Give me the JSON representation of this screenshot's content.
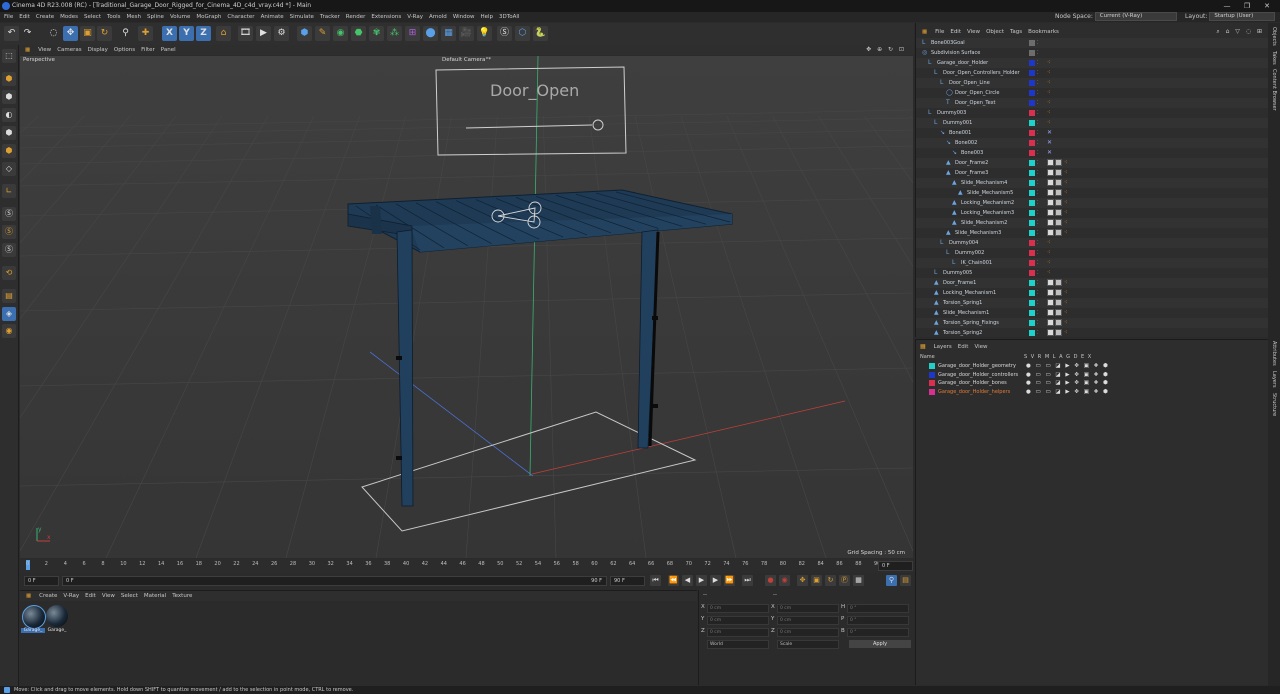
{
  "window": {
    "title": "Cinema 4D R23.008 (RC) - [Traditional_Garage_Door_Rigged_for_Cinema_4D_c4d_vray.c4d *] - Main",
    "controls": [
      "—",
      "❐",
      "✕"
    ]
  },
  "menubar": {
    "items": [
      "File",
      "Edit",
      "Create",
      "Modes",
      "Select",
      "Tools",
      "Mesh",
      "Spline",
      "Volume",
      "MoGraph",
      "Character",
      "Animate",
      "Simulate",
      "Tracker",
      "Render",
      "Extensions",
      "V-Ray",
      "Arnold",
      "Window",
      "Help",
      "3DToAll"
    ],
    "node_space_label": "Node Space:",
    "node_space_value": "Current (V-Ray)",
    "layout_label": "Layout:",
    "layout_value": "Startup (User)"
  },
  "toolbar": {
    "x_label": "X",
    "y_label": "Y",
    "z_label": "Z"
  },
  "viewport": {
    "menu": [
      "View",
      "Cameras",
      "Display",
      "Options",
      "Filter",
      "Panel"
    ],
    "label": "Perspective",
    "camera": "Default Camera",
    "camera_marker": "°*",
    "grid_spacing": "Grid Spacing : 50 cm",
    "scene_text": "Door_Open",
    "axis_y": "y",
    "axis_x": "x"
  },
  "timeline": {
    "ticks": [
      "0",
      "2",
      "4",
      "6",
      "8",
      "10",
      "12",
      "14",
      "16",
      "18",
      "20",
      "22",
      "24",
      "26",
      "28",
      "30",
      "32",
      "34",
      "36",
      "38",
      "40",
      "42",
      "44",
      "46",
      "48",
      "50",
      "52",
      "54",
      "56",
      "58",
      "60",
      "62",
      "64",
      "66",
      "68",
      "70",
      "72",
      "74",
      "76",
      "78",
      "80",
      "82",
      "84",
      "86",
      "88",
      "90"
    ],
    "end_field": "0 F"
  },
  "transport": {
    "current": "0 F",
    "start": "0 F",
    "range_end": "90 F",
    "end": "90 F"
  },
  "materials": {
    "menu": [
      "Create",
      "V-Ray",
      "Edit",
      "View",
      "Select",
      "Material",
      "Texture"
    ],
    "items": [
      {
        "name": "Garage_"
      },
      {
        "name": "Garage_"
      }
    ]
  },
  "attributes": {
    "header": "--",
    "col2": "--",
    "rows": [
      {
        "l1": "X",
        "v1": "0 cm",
        "l2": "X",
        "v2": "0 cm",
        "l3": "H",
        "v3": "0 °"
      },
      {
        "l1": "Y",
        "v1": "0 cm",
        "l2": "Y",
        "v2": "0 cm",
        "l3": "P",
        "v3": "0 °"
      },
      {
        "l1": "Z",
        "v1": "0 cm",
        "l2": "Z",
        "v2": "0 cm",
        "l3": "B",
        "v3": "0 °"
      }
    ],
    "coord_system": "World",
    "mode": "Scale",
    "apply": "Apply"
  },
  "objects": {
    "menu": [
      "File",
      "Edit",
      "View",
      "Object",
      "Tags",
      "Bookmarks"
    ],
    "rows": [
      {
        "name": "Bone003Goal",
        "indent": 0,
        "color": "#6d6d6d",
        "icon": "L"
      },
      {
        "name": "Subdivision Surface",
        "indent": 0,
        "color": "#6d6d6d",
        "icon": "◎"
      },
      {
        "name": "Garage_door_Holder",
        "indent": 1,
        "color": "#1f37c9",
        "icon": "L"
      },
      {
        "name": "Door_Open_Controllers_Holder",
        "indent": 2,
        "color": "#1f37c9",
        "icon": "L"
      },
      {
        "name": "Door_Open_Line",
        "indent": 3,
        "color": "#1f37c9",
        "icon": "L"
      },
      {
        "name": "Door_Open_Circle",
        "indent": 4,
        "color": "#1f37c9",
        "icon": "◯"
      },
      {
        "name": "Door_Open_Text",
        "indent": 4,
        "color": "#1f37c9",
        "icon": "T"
      },
      {
        "name": "Dummy003",
        "indent": 1,
        "color": "#d9304f",
        "icon": "L"
      },
      {
        "name": "Dummy001",
        "indent": 2,
        "color": "#1fd1c9",
        "icon": "L"
      },
      {
        "name": "Bone001",
        "indent": 3,
        "color": "#d9304f",
        "icon": "↘"
      },
      {
        "name": "Bone002",
        "indent": 4,
        "color": "#d9304f",
        "icon": "↘"
      },
      {
        "name": "Bone003",
        "indent": 5,
        "color": "#d9304f",
        "icon": "↘"
      },
      {
        "name": "Door_Frame2",
        "indent": 4,
        "color": "#1fd1c9",
        "icon": "▲"
      },
      {
        "name": "Door_Frame3",
        "indent": 4,
        "color": "#1fd1c9",
        "icon": "▲"
      },
      {
        "name": "Slide_Mechanism4",
        "indent": 5,
        "color": "#1fd1c9",
        "icon": "▲"
      },
      {
        "name": "Slide_Mechanism5",
        "indent": 6,
        "color": "#1fd1c9",
        "icon": "▲"
      },
      {
        "name": "Locking_Mechanism2",
        "indent": 5,
        "color": "#1fd1c9",
        "icon": "▲"
      },
      {
        "name": "Locking_Mechanism3",
        "indent": 5,
        "color": "#1fd1c9",
        "icon": "▲"
      },
      {
        "name": "Slide_Mechanism2",
        "indent": 5,
        "color": "#1fd1c9",
        "icon": "▲"
      },
      {
        "name": "Slide_Mechanism3",
        "indent": 4,
        "color": "#1fd1c9",
        "icon": "▲"
      },
      {
        "name": "Dummy004",
        "indent": 3,
        "color": "#d9304f",
        "icon": "L"
      },
      {
        "name": "Dummy002",
        "indent": 4,
        "color": "#d9304f",
        "icon": "L"
      },
      {
        "name": "IK_Chain001",
        "indent": 5,
        "color": "#d9304f",
        "icon": "L"
      },
      {
        "name": "Dummy005",
        "indent": 2,
        "color": "#d9304f",
        "icon": "L"
      },
      {
        "name": "Door_Frame1",
        "indent": 2,
        "color": "#1fd1c9",
        "icon": "▲"
      },
      {
        "name": "Locking_Mechanism1",
        "indent": 2,
        "color": "#1fd1c9",
        "icon": "▲"
      },
      {
        "name": "Torsion_Spring1",
        "indent": 2,
        "color": "#1fd1c9",
        "icon": "▲"
      },
      {
        "name": "Slide_Mechanism1",
        "indent": 2,
        "color": "#1fd1c9",
        "icon": "▲"
      },
      {
        "name": "Torsion_Spring_Fixings",
        "indent": 2,
        "color": "#1fd1c9",
        "icon": "▲"
      },
      {
        "name": "Torsion_Spring2",
        "indent": 2,
        "color": "#1fd1c9",
        "icon": "▲"
      }
    ]
  },
  "layers": {
    "menu": [
      "Layers",
      "Edit",
      "View"
    ],
    "header_name": "Name",
    "header_cols": "S V R M L A G D E X",
    "rows": [
      {
        "name": "Garage_door_Holder_geometry",
        "color": "#1fd1c9",
        "text_color": "#d8d8d8"
      },
      {
        "name": "Garage_door_Holder_controllers",
        "color": "#1f37c9",
        "text_color": "#d8d8d8"
      },
      {
        "name": "Garage_door_Holder_bones",
        "color": "#d9304f",
        "text_color": "#d8d8d8"
      },
      {
        "name": "Garage_door_Holder_helpers",
        "color": "#d93090",
        "text_color": "#e07b3a"
      }
    ]
  },
  "right_tabs": [
    "Objects",
    "Takes",
    "Content Browser",
    "Attributes",
    "Layers",
    "Structure"
  ],
  "status": "Move: Click and drag to move elements. Hold down SHIFT to quantize movement / add to the selection in point mode, CTRL to remove."
}
